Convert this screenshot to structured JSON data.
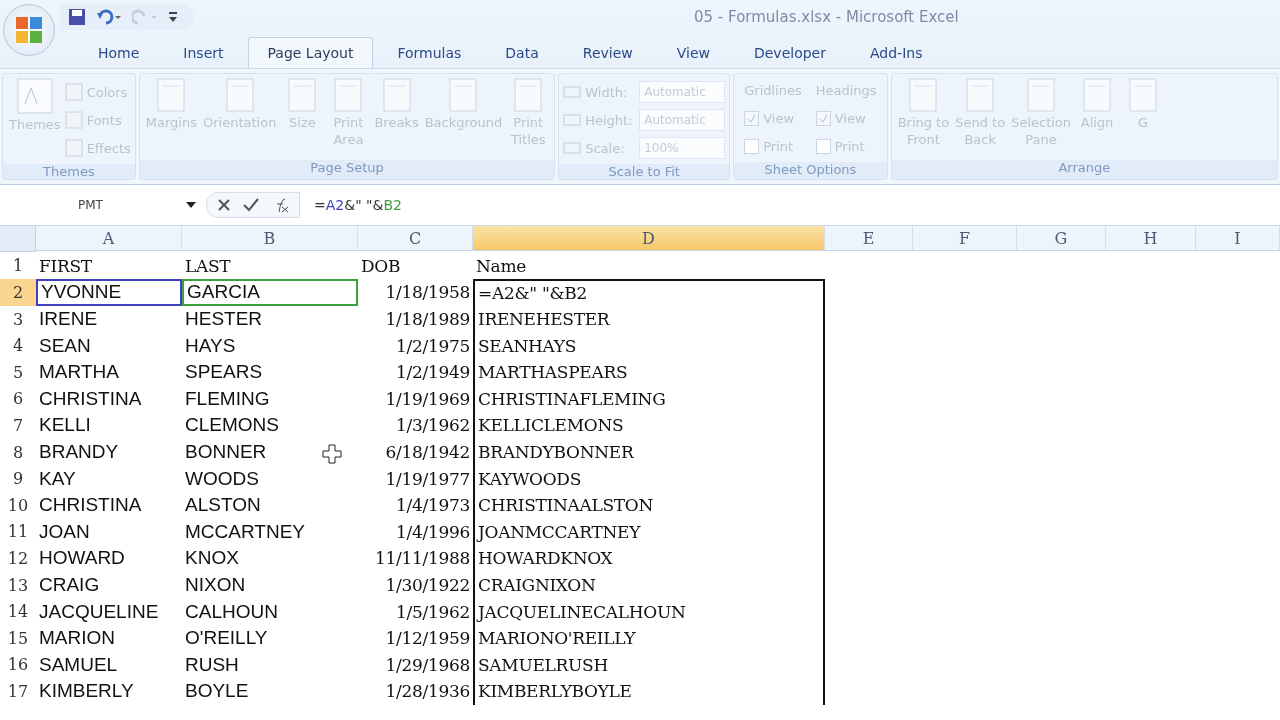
{
  "window": {
    "title": "05 - Formulas.xlsx - Microsoft Excel"
  },
  "tabs": [
    {
      "label": "Home",
      "selected": false
    },
    {
      "label": "Insert",
      "selected": false
    },
    {
      "label": "Page Layout",
      "selected": true
    },
    {
      "label": "Formulas",
      "selected": false
    },
    {
      "label": "Data",
      "selected": false
    },
    {
      "label": "Review",
      "selected": false
    },
    {
      "label": "View",
      "selected": false
    },
    {
      "label": "Developer",
      "selected": false
    },
    {
      "label": "Add-Ins",
      "selected": false
    }
  ],
  "ribbon": {
    "disabled": true,
    "groups": [
      {
        "title": "Themes",
        "kind": "themes",
        "big": [
          {
            "label": "Themes"
          }
        ],
        "small": [
          {
            "label": "Colors"
          },
          {
            "label": "Fonts"
          },
          {
            "label": "Effects"
          }
        ]
      },
      {
        "title": "Page Setup",
        "kind": "buttons",
        "big": [
          {
            "label": "Margins"
          },
          {
            "label": "Orientation"
          },
          {
            "label": "Size"
          },
          {
            "label": "Print",
            "label2": "Area"
          },
          {
            "label": "Breaks"
          },
          {
            "label": "Background"
          },
          {
            "label": "Print",
            "label2": "Titles"
          }
        ]
      },
      {
        "title": "Scale to Fit",
        "kind": "scale",
        "fields": [
          {
            "label": "Width:",
            "value": "Automatic"
          },
          {
            "label": "Height:",
            "value": "Automatic"
          },
          {
            "label": "Scale:",
            "value": "100%"
          }
        ]
      },
      {
        "title": "Sheet Options",
        "kind": "options",
        "columns": [
          {
            "heading": "Gridlines",
            "view": {
              "label": "View",
              "checked": true
            },
            "print": {
              "label": "Print",
              "checked": false
            }
          },
          {
            "heading": "Headings",
            "view": {
              "label": "View",
              "checked": true
            },
            "print": {
              "label": "Print",
              "checked": false
            }
          }
        ]
      },
      {
        "title": "Arrange",
        "kind": "buttons",
        "big": [
          {
            "label": "Bring to",
            "label2": "Front"
          },
          {
            "label": "Send to",
            "label2": "Back"
          },
          {
            "label": "Selection",
            "label2": "Pane"
          },
          {
            "label": "Align"
          },
          {
            "label": "G"
          }
        ]
      }
    ]
  },
  "name_box": "PMT",
  "formula": [
    {
      "text": "=",
      "color": "#333333"
    },
    {
      "text": "A2",
      "color": "#4040c0"
    },
    {
      "text": "&\" \"&",
      "color": "#333333"
    },
    {
      "text": "B2",
      "color": "#40a040"
    }
  ],
  "columns": [
    {
      "label": "A",
      "selected": false
    },
    {
      "label": "B",
      "selected": false
    },
    {
      "label": "C",
      "selected": false
    },
    {
      "label": "D",
      "selected": true
    },
    {
      "label": "E",
      "selected": false
    },
    {
      "label": "F",
      "selected": false
    },
    {
      "label": "G",
      "selected": false
    },
    {
      "label": "H",
      "selected": false
    },
    {
      "label": "I",
      "selected": false
    }
  ],
  "rows": [
    {
      "label": "1",
      "selected": false,
      "cells": [
        {
          "text": "FIRST"
        },
        {
          "text": "LAST"
        },
        {
          "text": "DOB"
        },
        {
          "text": "Name"
        }
      ]
    },
    {
      "label": "2",
      "selected": true,
      "cells": [
        {
          "text": "YVONNE",
          "color": "#4040c0"
        },
        {
          "text": "GARCIA",
          "color": "#40a040"
        },
        {
          "text": "1/18/1958"
        },
        {
          "text": "=A2&\" \"&B2"
        }
      ]
    },
    {
      "label": "3",
      "selected": false,
      "cells": [
        {
          "text": "IRENE"
        },
        {
          "text": "HESTER"
        },
        {
          "text": "1/18/1989"
        },
        {
          "text": "IRENEHESTER"
        }
      ]
    },
    {
      "label": "4",
      "selected": false,
      "cells": [
        {
          "text": "SEAN"
        },
        {
          "text": "HAYS"
        },
        {
          "text": "1/2/1975"
        },
        {
          "text": "SEANHAYS"
        }
      ]
    },
    {
      "label": "5",
      "selected": false,
      "cells": [
        {
          "text": "MARTHA"
        },
        {
          "text": "SPEARS"
        },
        {
          "text": "1/2/1949"
        },
        {
          "text": "MARTHASPEARS"
        }
      ]
    },
    {
      "label": "6",
      "selected": false,
      "cells": [
        {
          "text": "CHRISTINA"
        },
        {
          "text": "FLEMING"
        },
        {
          "text": "1/19/1969"
        },
        {
          "text": "CHRISTINAFLEMING"
        }
      ]
    },
    {
      "label": "7",
      "selected": false,
      "cells": [
        {
          "text": "KELLI"
        },
        {
          "text": "CLEMONS"
        },
        {
          "text": "1/3/1962"
        },
        {
          "text": "KELLICLEMONS"
        }
      ]
    },
    {
      "label": "8",
      "selected": false,
      "cells": [
        {
          "text": "BRANDY"
        },
        {
          "text": "BONNER"
        },
        {
          "text": "6/18/1942"
        },
        {
          "text": "BRANDYBONNER"
        }
      ]
    },
    {
      "label": "9",
      "selected": false,
      "cells": [
        {
          "text": "KAY"
        },
        {
          "text": "WOODS"
        },
        {
          "text": "1/19/1977"
        },
        {
          "text": "KAYWOODS"
        }
      ]
    },
    {
      "label": "10",
      "selected": false,
      "cells": [
        {
          "text": "CHRISTINA"
        },
        {
          "text": "ALSTON"
        },
        {
          "text": "1/4/1973"
        },
        {
          "text": "CHRISTINAALSTON"
        }
      ]
    },
    {
      "label": "11",
      "selected": false,
      "cells": [
        {
          "text": "JOAN"
        },
        {
          "text": "MCCARTNEY"
        },
        {
          "text": "1/4/1996"
        },
        {
          "text": "JOANMCCARTNEY"
        }
      ]
    },
    {
      "label": "12",
      "selected": false,
      "cells": [
        {
          "text": "HOWARD"
        },
        {
          "text": "KNOX"
        },
        {
          "text": "11/11/1988"
        },
        {
          "text": "HOWARDKNOX"
        }
      ]
    },
    {
      "label": "13",
      "selected": false,
      "cells": [
        {
          "text": "CRAIG"
        },
        {
          "text": "NIXON"
        },
        {
          "text": "1/30/1922"
        },
        {
          "text": "CRAIGNIXON"
        }
      ]
    },
    {
      "label": "14",
      "selected": false,
      "cells": [
        {
          "text": "JACQUELINE"
        },
        {
          "text": "CALHOUN"
        },
        {
          "text": "1/5/1962"
        },
        {
          "text": "JACQUELINECALHOUN"
        }
      ]
    },
    {
      "label": "15",
      "selected": false,
      "cells": [
        {
          "text": "MARION"
        },
        {
          "text": "O'REILLY"
        },
        {
          "text": "1/12/1959"
        },
        {
          "text": "MARIONO'REILLY"
        }
      ]
    },
    {
      "label": "16",
      "selected": false,
      "cells": [
        {
          "text": "SAMUEL"
        },
        {
          "text": "RUSH"
        },
        {
          "text": "1/29/1968"
        },
        {
          "text": "SAMUELRUSH"
        }
      ]
    },
    {
      "label": "17",
      "selected": false,
      "cells": [
        {
          "text": "KIMBERLY"
        },
        {
          "text": "BOYLE"
        },
        {
          "text": "1/28/1936"
        },
        {
          "text": "KIMBERLYBOYLE"
        }
      ]
    }
  ]
}
